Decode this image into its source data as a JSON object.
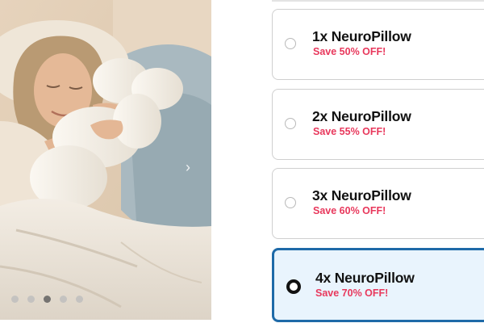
{
  "gallery": {
    "image_alt": "Woman sleeping while hugging a white NeuroPillow",
    "next_icon": "chevron-right-icon",
    "slide_count": 5,
    "active_slide": 3
  },
  "bundle_options": [
    {
      "title": "1x NeuroPillow",
      "savings": "Save 50% OFF!",
      "selected": false
    },
    {
      "title": "2x NeuroPillow",
      "savings": "Save 55% OFF!",
      "selected": false
    },
    {
      "title": "3x NeuroPillow",
      "savings": "Save 60% OFF!",
      "selected": false
    },
    {
      "title": "4x NeuroPillow",
      "savings": "Save 70% OFF!",
      "selected": true
    }
  ],
  "colors": {
    "savings_text": "#e8385c",
    "selected_border": "#1e6aa8",
    "selected_background": "#e9f4fd"
  }
}
